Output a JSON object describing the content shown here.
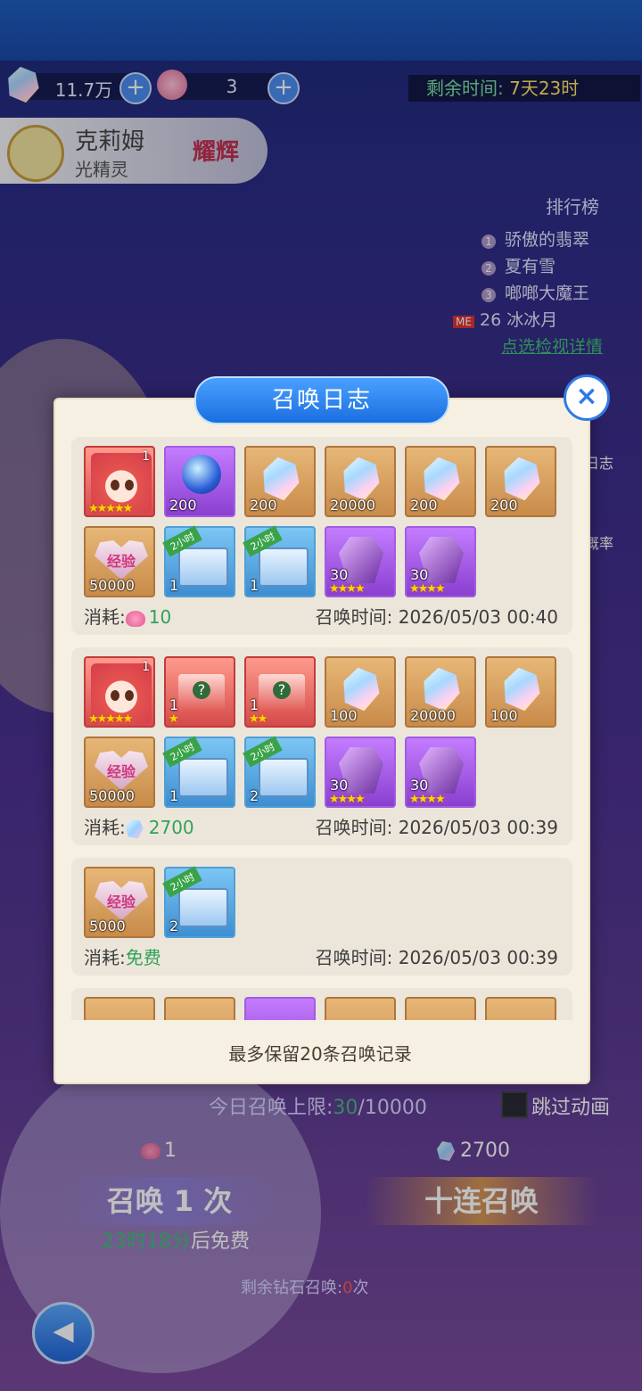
{
  "resources": {
    "gems": "11.7万",
    "flowers": "3"
  },
  "timer": {
    "label": "剩余时间:",
    "value": "7天23时"
  },
  "hero": {
    "name": "克莉姆",
    "type": "光精灵",
    "badge": "耀辉"
  },
  "ranking": {
    "title": "排行榜",
    "entries": [
      {
        "no": "1",
        "name": "骄傲的翡翠"
      },
      {
        "no": "2",
        "name": "夏有雪"
      },
      {
        "no": "3",
        "name": "啷啷大魔王"
      },
      {
        "no": "26",
        "name": "冰冰月",
        "prefix": "ME"
      }
    ],
    "link": "点选检视详情"
  },
  "side": {
    "log": "日志",
    "rate": "概率"
  },
  "dialog": {
    "title": "召唤日志",
    "close": "×",
    "footer": "最多保留20条召唤记录",
    "records": [
      {
        "items": [
          {
            "kind": "girl",
            "qty": "",
            "tl": "1",
            "stars": "★★★★★"
          },
          {
            "kind": "orb",
            "qty": "200"
          },
          {
            "kind": "crystal",
            "qty": "200"
          },
          {
            "kind": "crystal",
            "qty": "20000"
          },
          {
            "kind": "crystal",
            "qty": "200"
          },
          {
            "kind": "crystal",
            "qty": "200"
          },
          {
            "kind": "exp",
            "qty": "50000",
            "label": "经验"
          },
          {
            "kind": "chest",
            "qty": "1",
            "ribbon": "2小时"
          },
          {
            "kind": "chest",
            "qty": "1",
            "ribbon": "2小时"
          },
          {
            "kind": "gem",
            "qty": "30",
            "stars": "★★★★"
          },
          {
            "kind": "gem",
            "qty": "30",
            "stars": "★★★★"
          }
        ],
        "cost_label": "消耗:",
        "cost_value": "10",
        "cost_icon": "flower",
        "time_label": "召唤时间:",
        "time": "2026/05/03 00:40"
      },
      {
        "items": [
          {
            "kind": "girl",
            "qty": "",
            "tl": "1",
            "stars": "★★★★★"
          },
          {
            "kind": "redbox",
            "qty": "1",
            "stars": "★"
          },
          {
            "kind": "redbox",
            "qty": "1",
            "stars": "★★"
          },
          {
            "kind": "crystal",
            "qty": "100"
          },
          {
            "kind": "crystal",
            "qty": "20000"
          },
          {
            "kind": "crystal",
            "qty": "100"
          },
          {
            "kind": "exp",
            "qty": "50000",
            "label": "经验"
          },
          {
            "kind": "chest",
            "qty": "1",
            "ribbon": "2小时"
          },
          {
            "kind": "chest",
            "qty": "2",
            "ribbon": "2小时"
          },
          {
            "kind": "gem",
            "qty": "30",
            "stars": "★★★★"
          },
          {
            "kind": "gem",
            "qty": "30",
            "stars": "★★★★"
          }
        ],
        "cost_label": "消耗:",
        "cost_value": "2700",
        "cost_icon": "diamond",
        "time_label": "召唤时间:",
        "time": "2026/05/03 00:39"
      },
      {
        "items": [
          {
            "kind": "exp",
            "qty": "5000",
            "label": "经验"
          },
          {
            "kind": "chest",
            "qty": "2",
            "ribbon": "2小时"
          }
        ],
        "cost_label": "消耗:",
        "cost_value": "免费",
        "cost_icon": "",
        "time_label": "召唤时间:",
        "time": "2026/05/03 00:39"
      }
    ]
  },
  "bottom": {
    "daily_label": "今日召唤上限:",
    "daily_count": "30",
    "daily_max": "/10000",
    "skip": "跳过动画",
    "flower_cost": "1",
    "diamond_cost": "2700",
    "summon_once": "召唤 1 次",
    "summon_ten": "十连召唤",
    "free_in": "23时18分",
    "free_suffix": "后免费",
    "remaining_label": "剩余钻石召唤:",
    "remaining_count": "0",
    "remaining_unit": "次"
  }
}
